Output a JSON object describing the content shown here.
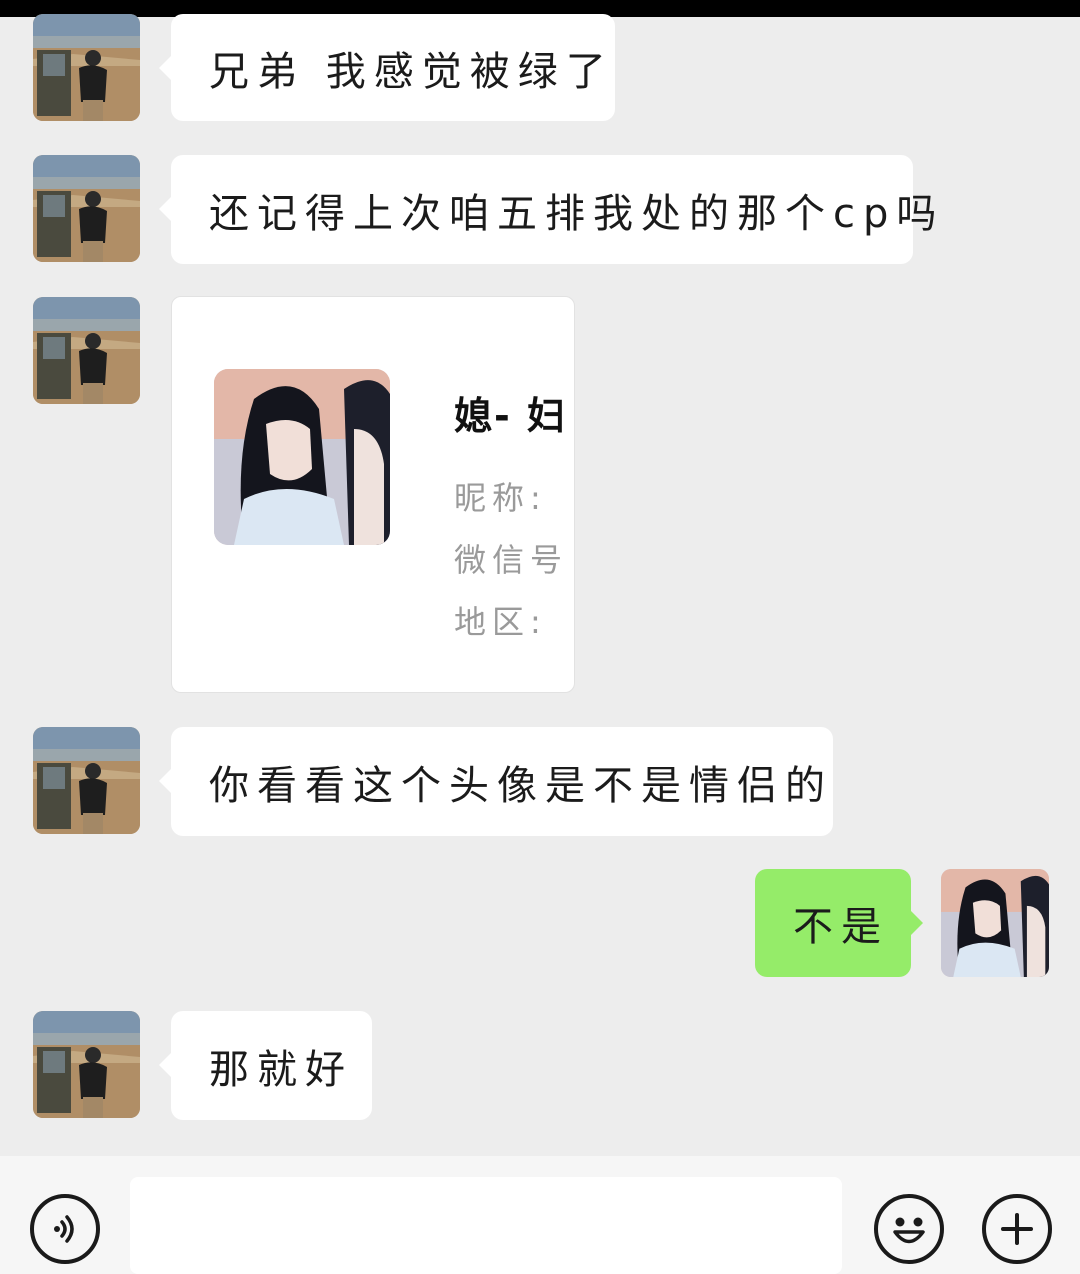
{
  "messages": [
    {
      "side": "left",
      "type": "text",
      "text": "兄弟 我感觉被绿了"
    },
    {
      "side": "left",
      "type": "text",
      "text": "还记得上次咱五排我处的那个cp吗"
    },
    {
      "side": "left",
      "type": "contact_card",
      "name": "媳- 妇",
      "nickname_label": "昵称:",
      "wechat_id_label": "微信号",
      "region_label": "地区:"
    },
    {
      "side": "left",
      "type": "text",
      "text": "你看看这个头像是不是情侣的"
    },
    {
      "side": "right",
      "type": "text",
      "text": "不是"
    },
    {
      "side": "left",
      "type": "text",
      "text": "那就好"
    }
  ],
  "input_bar": {
    "voice_icon": "voice-icon",
    "emoji_icon": "emoji-icon",
    "plus_icon": "plus-icon"
  },
  "colors": {
    "background": "#ededed",
    "self_bubble": "#95ec69",
    "other_bubble": "#ffffff"
  }
}
